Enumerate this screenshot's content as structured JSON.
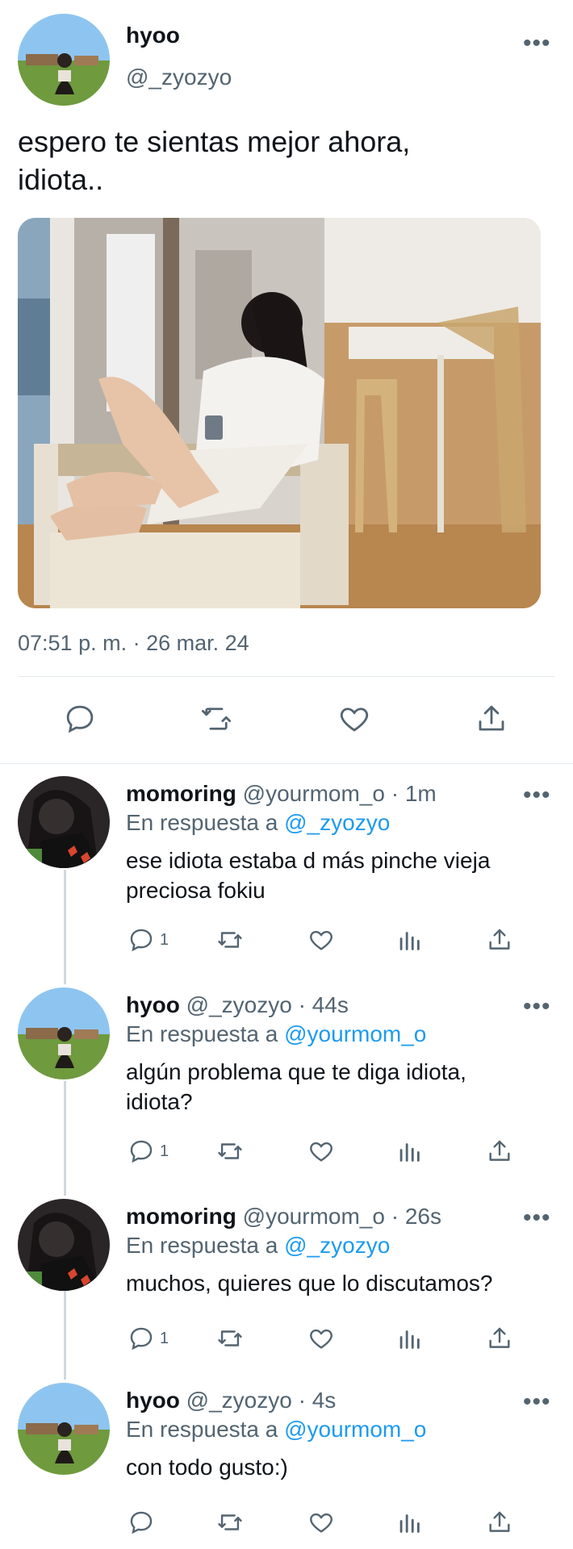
{
  "tweet": {
    "author_name": "hyoo",
    "author_handle": "@_zyozyo",
    "text_line1": "espero te sientas mejor ahora,",
    "text_line2": "idiota..",
    "timestamp": "07:51 p. m. · 26 mar. 24",
    "more_label": "•••",
    "actions": [
      "reply-icon",
      "retweet-icon",
      "like-icon",
      "share-icon"
    ]
  },
  "replies": [
    {
      "name": "momoring",
      "handle": "@yourmom_o",
      "time": "· 1m",
      "reply_prefix": "En respuesta a",
      "reply_to": "@_zyozyo",
      "line1": "ese idiota estaba d más pinche vieja",
      "line2": "preciosa fokiu",
      "reply_count": "1"
    },
    {
      "name": "hyoo",
      "handle": "@_zyozyo",
      "time": "· 44s",
      "reply_prefix": "En respuesta a",
      "reply_to": "@yourmom_o",
      "line1": "algún problema que te diga idiota,",
      "line2": "idiota?",
      "reply_count": "1"
    },
    {
      "name": "momoring",
      "handle": "@yourmom_o",
      "time": "· 26s",
      "reply_prefix": "En respuesta a",
      "reply_to": "@_zyozyo",
      "line1": "muchos, quieres que lo discutamos?",
      "line2": "",
      "reply_count": "1"
    },
    {
      "name": "hyoo",
      "handle": "@_zyozyo",
      "time": "· 4s",
      "reply_prefix": "En respuesta a",
      "reply_to": "@yourmom_o",
      "line1": "con todo gusto:)",
      "line2": "",
      "reply_count": ""
    }
  ],
  "colors": {
    "accent": "#1d9bf0",
    "muted": "#536471",
    "divider": "#e1e8ed"
  }
}
